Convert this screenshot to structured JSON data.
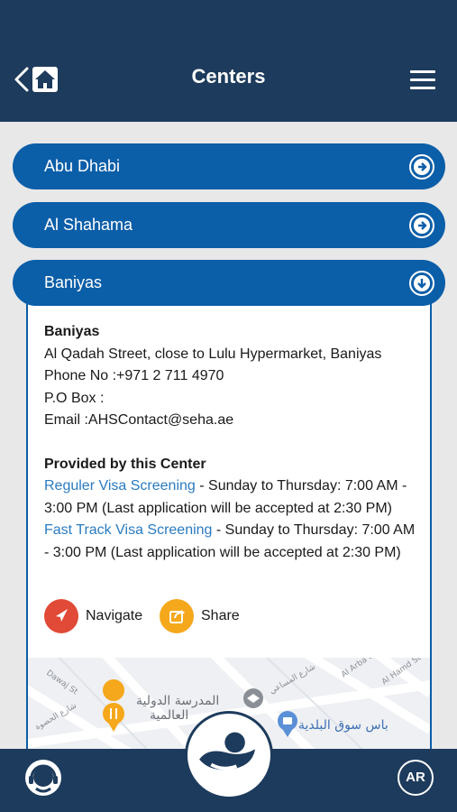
{
  "header": {
    "title": "Centers"
  },
  "accordion": [
    {
      "label": "Abu Dhabi",
      "state": "collapsed"
    },
    {
      "label": "Al Shahama",
      "state": "collapsed"
    },
    {
      "label": "Baniyas",
      "state": "expanded"
    }
  ],
  "center": {
    "name": "Baniyas",
    "address": "Al Qadah Street, close to Lulu Hypermarket, Baniyas",
    "phone": "Phone No :+971 2 711 4970",
    "po_box": "P.O Box :",
    "email": "Email :AHSContact@seha.ae",
    "services_heading": "Provided by this Center",
    "services": [
      {
        "name": "Reguler Visa Screening",
        "hours": " - Sunday to Thursday: 7:00 AM - 3:00 PM (Last application will be accepted at 2:30 PM)"
      },
      {
        "name": "Fast Track Visa Screening",
        "hours": " - Sunday to Thursday: 7:00 AM - 3:00 PM (Last application will be accepted at 2:30 PM)"
      }
    ],
    "navigate_label": "Navigate",
    "share_label": "Share"
  },
  "map": {
    "labels": {
      "school_ar_1": "المدرسة الدولية",
      "school_ar_2": "العالمية",
      "market_ar": "باس سوق البلدية",
      "street_1": "Al Arba'een St",
      "street_2": "Al Hamd St",
      "street_ar_1": "شارع المساعي",
      "street_ar_2": "شارع الحصوة"
    }
  },
  "bottom": {
    "ar_label": "AR"
  },
  "colors": {
    "header_bg": "#1d3b5c",
    "accent_blue": "#0b5ea8",
    "navigate_red": "#e04a36",
    "share_orange": "#f6a81c",
    "link_blue": "#2a7bc0"
  }
}
